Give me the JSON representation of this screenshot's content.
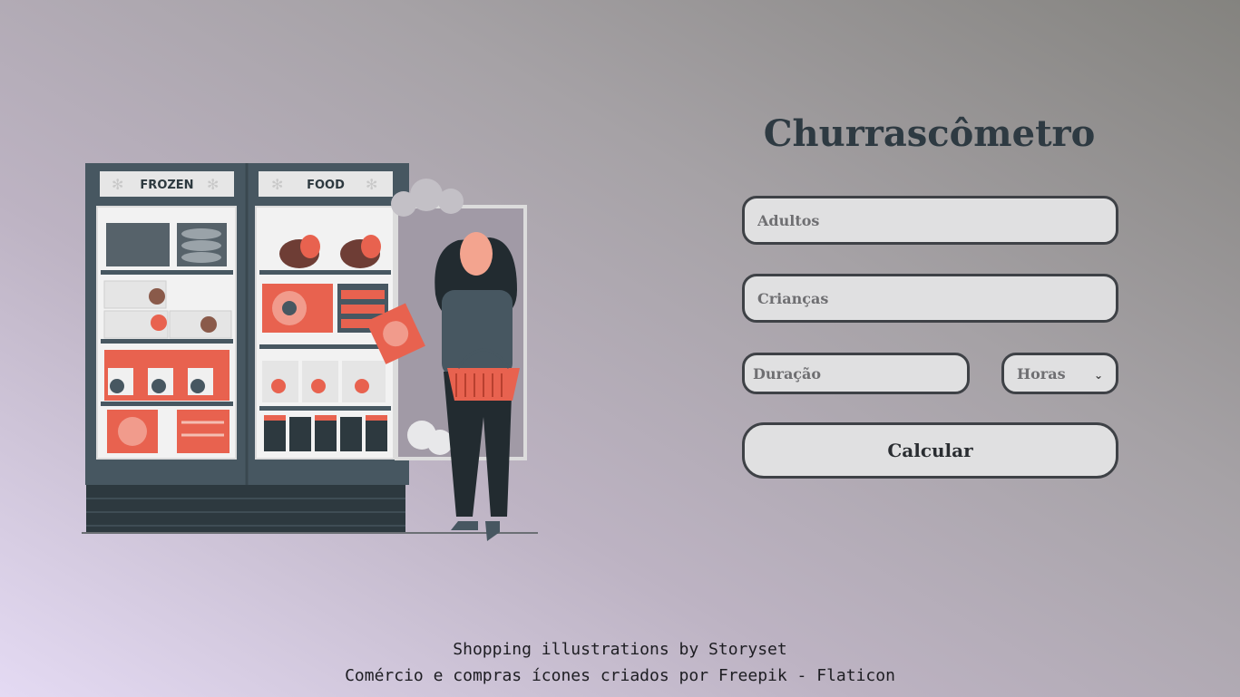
{
  "illustration": {
    "sign_left": "FROZEN",
    "sign_right": "FOOD"
  },
  "form": {
    "title": "Churrascômetro",
    "adults_placeholder": "Adultos",
    "children_placeholder": "Crianças",
    "duration_placeholder": "Duração",
    "unit_selected": "Horas",
    "submit_label": "Calcular"
  },
  "footer": {
    "line1": "Shopping illustrations by Storyset",
    "line2": "Comércio e compras ícones criados por Freepik - Flaticon"
  },
  "colors": {
    "fridge": "#475761",
    "accent": "#e8624f",
    "border": "#3e4146",
    "field_bg": "#e0e0e1",
    "title": "#2e3a42"
  }
}
